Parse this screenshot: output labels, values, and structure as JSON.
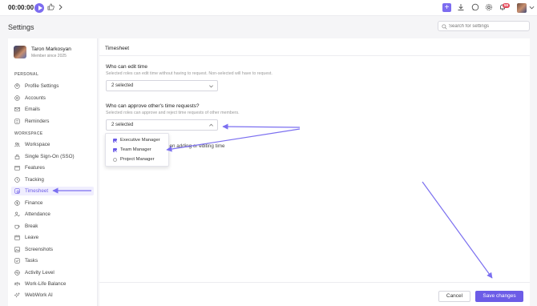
{
  "topbar": {
    "timer": "00:00:00",
    "notification_count": "59"
  },
  "header": {
    "title": "Settings",
    "search_placeholder": "Search for settings"
  },
  "profile": {
    "name": "Taron Markosyan",
    "subtitle": "Member since 2025"
  },
  "sidebar": {
    "personal_label": "PERSONAL",
    "workspace_label": "WORKSPACE",
    "personal_items": [
      {
        "label": "Profile Settings",
        "icon": "user-gear-icon"
      },
      {
        "label": "Accounts",
        "icon": "at-icon"
      },
      {
        "label": "Emails",
        "icon": "mail-icon"
      },
      {
        "label": "Reminders",
        "icon": "bell-list-icon"
      }
    ],
    "workspace_items": [
      {
        "label": "Workspace",
        "icon": "people-icon"
      },
      {
        "label": "Single Sign-On (SSO)",
        "icon": "lock-icon"
      },
      {
        "label": "Features",
        "icon": "box-icon"
      },
      {
        "label": "Tracking",
        "icon": "clock-icon"
      },
      {
        "label": "Timesheet",
        "icon": "timesheet-icon",
        "active": true
      },
      {
        "label": "Finance",
        "icon": "dollar-icon"
      },
      {
        "label": "Attendance",
        "icon": "person-check-icon"
      },
      {
        "label": "Break",
        "icon": "coffee-icon"
      },
      {
        "label": "Leave",
        "icon": "calendar-icon"
      },
      {
        "label": "Screenshots",
        "icon": "image-icon"
      },
      {
        "label": "Tasks",
        "icon": "checklist-icon"
      },
      {
        "label": "Activity Level",
        "icon": "activity-icon"
      },
      {
        "label": "Work-Life Balance",
        "icon": "balance-icon"
      },
      {
        "label": "WebWork AI",
        "icon": "sparkle-icon"
      }
    ]
  },
  "main": {
    "title": "Timesheet",
    "edit_time": {
      "label": "Who can edit time",
      "description": "Selected roles can edit time without having to request. Non-selected will have to request.",
      "value": "2 selected"
    },
    "approve_requests": {
      "label": "Who can approve other's time requests?",
      "description": "Selected roles can approve and reject time requests of other members.",
      "value": "2 selected",
      "options": [
        {
          "label": "Executive Manager",
          "checked": true
        },
        {
          "label": "Team Manager",
          "checked": true
        },
        {
          "label": "Project Manager",
          "checked": false
        }
      ]
    },
    "partial_hint": "hen adding or editing time"
  },
  "footer": {
    "cancel_label": "Cancel",
    "save_label": "Save changes"
  },
  "colors": {
    "accent": "#6c5ce7",
    "annotation_arrow": "#7b6ff0"
  }
}
